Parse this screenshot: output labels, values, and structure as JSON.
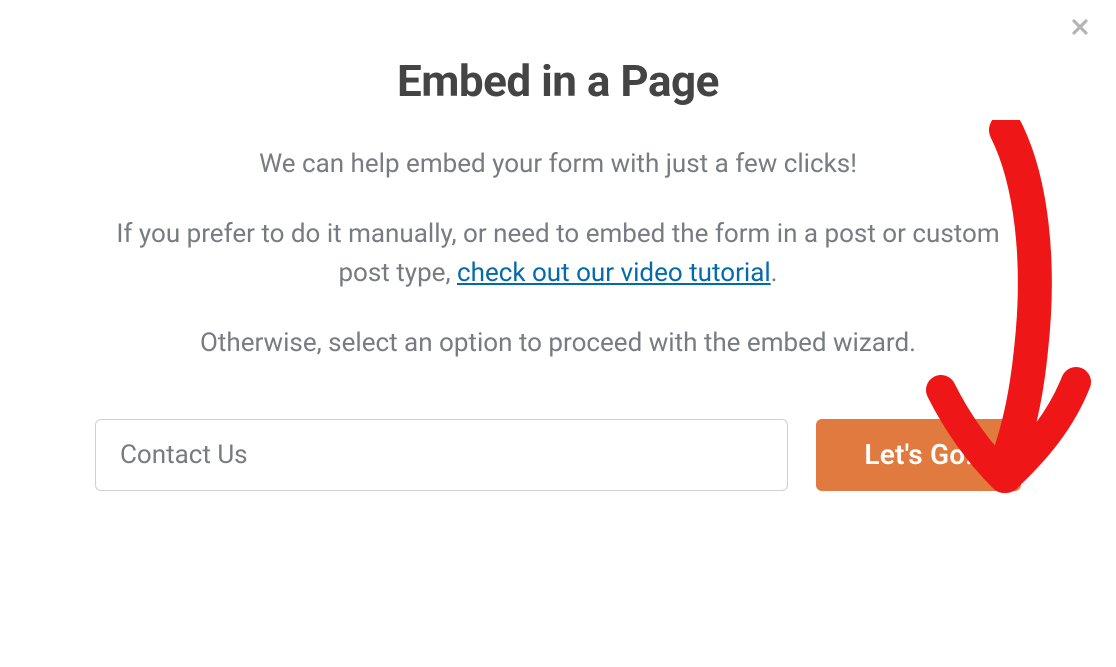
{
  "modal": {
    "title": "Embed in a Page",
    "subtitle": "We can help embed your form with just a few clicks!",
    "description_prefix": "If you prefer to do it manually, or need to embed the form in a post or custom post type, ",
    "link_text": "check out our video tutorial",
    "description_suffix": ".",
    "hint": "Otherwise, select an option to proceed with the embed wizard.",
    "input_value": "Contact Us",
    "button_label": "Let's Go!"
  }
}
